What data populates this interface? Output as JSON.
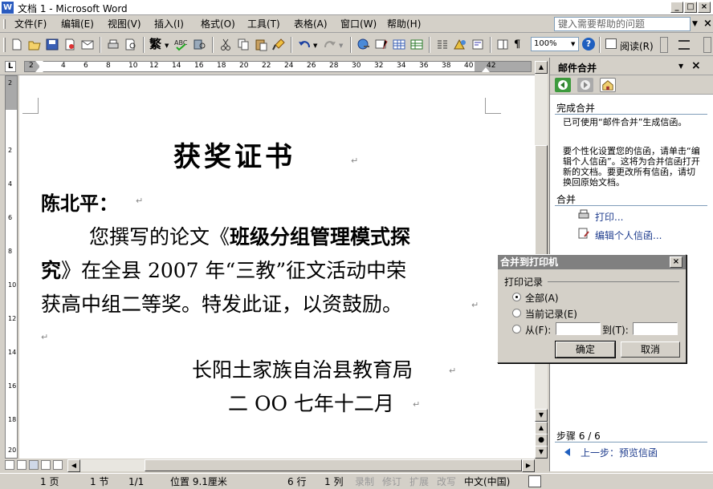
{
  "window": {
    "title": "文档 1 - Microsoft Word",
    "app_icon": "W"
  },
  "menubar": {
    "items": [
      "文件(F)",
      "编辑(E)",
      "视图(V)",
      "插入(I)",
      "格式(O)",
      "工具(T)",
      "表格(A)",
      "窗口(W)",
      "帮助(H)"
    ],
    "help_placeholder": "键入需要帮助的问题"
  },
  "toolbar": {
    "zoom": "100%",
    "read_label": "阅读(R)"
  },
  "ruler": {
    "ticks": [
      "2",
      "2",
      "4",
      "6",
      "8",
      "10",
      "12",
      "14",
      "16",
      "18",
      "20",
      "22",
      "24",
      "26",
      "28",
      "30",
      "32",
      "34",
      "36",
      "38",
      "40",
      "42"
    ],
    "vticks": [
      "2",
      "2",
      "4",
      "6",
      "8",
      "10",
      "12",
      "14",
      "16",
      "18",
      "20"
    ]
  },
  "document": {
    "title": "获奖证书",
    "recipient": "陈北平：",
    "line1_prefix": "您撰写的论文《",
    "line1_bold": "班级分组管理模式探",
    "line2_bold": "究",
    "line2_rest": "》在全县 2007 年“三教”征文活动中荣",
    "line3": "获高中组二等奖。特发此证，以资鼓励。",
    "issuer": "长阳土家族自治县教育局",
    "date": "二 OO 七年十二月",
    "para_mark": "↵"
  },
  "taskpane": {
    "title": "邮件合并",
    "section_complete": "完成合并",
    "complete_text": "已可使用“邮件合并”生成信函。",
    "personalize_text": "要个性化设置您的信函，请单击“编辑个人信函”。这将为合并信函打开新的文档。要更改所有信函，请切换回原始文档。",
    "section_merge": "合并",
    "link_print": "打印...",
    "link_edit": "编辑个人信函...",
    "step": "步骤 6 / 6",
    "prev_step": "上一步：预览信函"
  },
  "dialog": {
    "title": "合并到打印机",
    "group": "打印记录",
    "opt_all": "全部(A)",
    "opt_current": "当前记录(E)",
    "opt_from": "从(F):",
    "opt_to": "到(T):",
    "from_value": "",
    "to_value": "",
    "ok": "确定",
    "cancel": "取消"
  },
  "statusbar": {
    "page": "1 页",
    "section": "1 节",
    "pages": "1/1",
    "position": "位置 9.1厘米",
    "line": "6 行",
    "col": "1 列",
    "rec": "录制",
    "trk": "修订",
    "ext": "扩展",
    "ovr": "改写",
    "lang": "中文(中国)"
  }
}
